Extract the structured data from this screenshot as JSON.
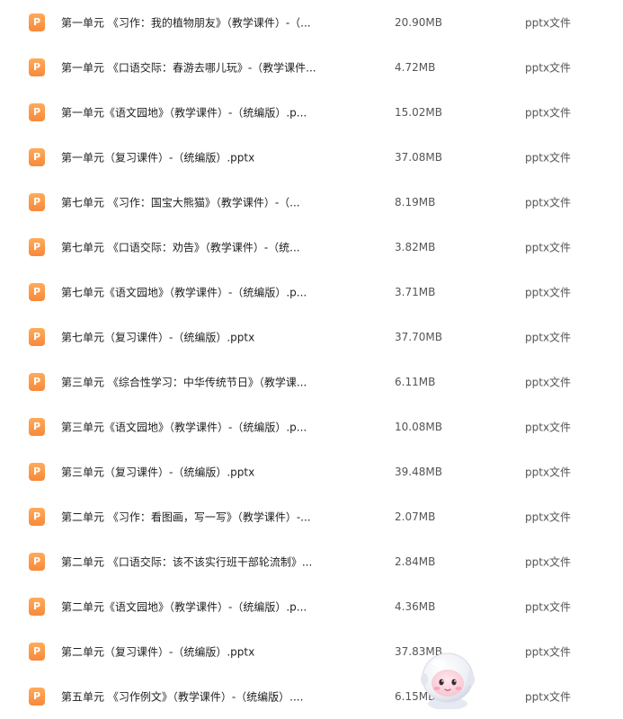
{
  "files": [
    {
      "icon": "P",
      "name": "第一单元 《习作：我的植物朋友》（教学课件）-（...",
      "size": "20.90MB",
      "type": "pptx文件"
    },
    {
      "icon": "P",
      "name": "第一单元 《口语交际：春游去哪儿玩》-（教学课件...",
      "size": "4.72MB",
      "type": "pptx文件"
    },
    {
      "icon": "P",
      "name": "第一单元《语文园地》（教学课件）-（统编版）.p...",
      "size": "15.02MB",
      "type": "pptx文件"
    },
    {
      "icon": "P",
      "name": "第一单元（复习课件）-（统编版）.pptx",
      "size": "37.08MB",
      "type": "pptx文件"
    },
    {
      "icon": "P",
      "name": "第七单元 《习作：国宝大熊猫》（教学课件）-（...",
      "size": "8.19MB",
      "type": "pptx文件"
    },
    {
      "icon": "P",
      "name": "第七单元 《口语交际：劝告》（教学课件）-（统...",
      "size": "3.82MB",
      "type": "pptx文件"
    },
    {
      "icon": "P",
      "name": "第七单元《语文园地》（教学课件）-（统编版）.p...",
      "size": "3.71MB",
      "type": "pptx文件"
    },
    {
      "icon": "P",
      "name": "第七单元（复习课件）-（统编版）.pptx",
      "size": "37.70MB",
      "type": "pptx文件"
    },
    {
      "icon": "P",
      "name": "第三单元 《综合性学习：中华传统节日》（教学课...",
      "size": "6.11MB",
      "type": "pptx文件"
    },
    {
      "icon": "P",
      "name": "第三单元《语文园地》（教学课件）-（统编版）.p...",
      "size": "10.08MB",
      "type": "pptx文件"
    },
    {
      "icon": "P",
      "name": "第三单元（复习课件）-（统编版）.pptx",
      "size": "39.48MB",
      "type": "pptx文件"
    },
    {
      "icon": "P",
      "name": "第二单元 《习作：看图画，写一写》（教学课件）-...",
      "size": "2.07MB",
      "type": "pptx文件"
    },
    {
      "icon": "P",
      "name": "第二单元 《口语交际：该不该实行班干部轮流制》...",
      "size": "2.84MB",
      "type": "pptx文件"
    },
    {
      "icon": "P",
      "name": "第二单元《语文园地》（教学课件）-（统编版）.p...",
      "size": "4.36MB",
      "type": "pptx文件"
    },
    {
      "icon": "P",
      "name": "第二单元（复习课件）-（统编版）.pptx",
      "size": "37.83MB",
      "type": "pptx文件"
    },
    {
      "icon": "P",
      "name": "第五单元 《习作例文》（教学课件）-（统编版）....",
      "size": "6.15MB",
      "type": "pptx文件"
    }
  ],
  "colors": {
    "icon_orange": "#f7893a",
    "name_text": "#1f1f1f",
    "meta_text": "#555555"
  },
  "mascot_icon": "astronaut-mascot-icon"
}
